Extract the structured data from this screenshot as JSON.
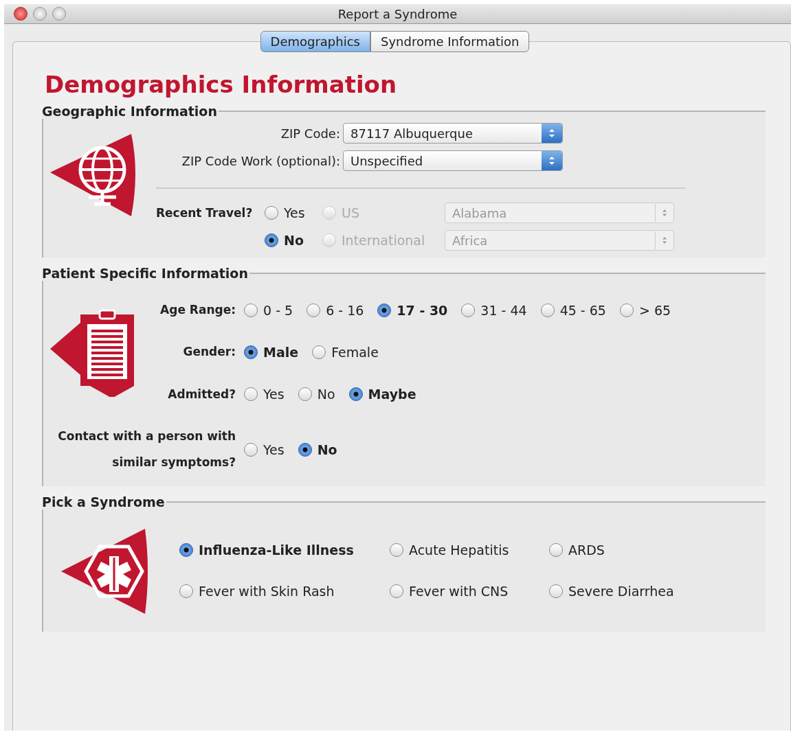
{
  "window": {
    "title": "Report a Syndrome"
  },
  "tabs": [
    {
      "label": "Demographics",
      "selected": true
    },
    {
      "label": "Syndrome Information",
      "selected": false
    }
  ],
  "heading": "Demographics Information",
  "geographic": {
    "title": "Geographic Information",
    "fields": [
      {
        "label": "ZIP Code:",
        "value": "87117 Albuquerque"
      },
      {
        "label": "ZIP Code Work (optional):",
        "value": "Unspecified"
      }
    ],
    "travel": {
      "label": "Recent Travel?",
      "rows": [
        {
          "answer": {
            "label": "Yes",
            "selected": false
          },
          "scope": {
            "label": "US",
            "selected": false,
            "disabled": true
          },
          "place": {
            "value": "Alabama",
            "disabled": true
          }
        },
        {
          "answer": {
            "label": "No",
            "selected": true
          },
          "scope": {
            "label": "International",
            "selected": false,
            "disabled": true
          },
          "place": {
            "value": "Africa",
            "disabled": true
          }
        }
      ]
    }
  },
  "patient": {
    "title": "Patient Specific Information",
    "questions": [
      {
        "label_lines": [
          "Age Range:"
        ],
        "options": [
          {
            "label": "0 - 5",
            "selected": false
          },
          {
            "label": "6 - 16",
            "selected": false
          },
          {
            "label": "17 - 30",
            "selected": true
          },
          {
            "label": "31 - 44",
            "selected": false
          },
          {
            "label": "45 - 65",
            "selected": false
          },
          {
            "label": "> 65",
            "selected": false
          }
        ]
      },
      {
        "label_lines": [
          "Gender:"
        ],
        "options": [
          {
            "label": "Male",
            "selected": true
          },
          {
            "label": "Female",
            "selected": false
          }
        ]
      },
      {
        "label_lines": [
          "Admitted?"
        ],
        "options": [
          {
            "label": "Yes",
            "selected": false
          },
          {
            "label": "No",
            "selected": false
          },
          {
            "label": "Maybe",
            "selected": true
          }
        ]
      },
      {
        "label_lines": [
          "Contact with a person with",
          "similar symptoms?"
        ],
        "options": [
          {
            "label": "Yes",
            "selected": false
          },
          {
            "label": "No",
            "selected": true
          }
        ]
      }
    ]
  },
  "syndrome": {
    "title": "Pick a Syndrome",
    "options": [
      {
        "label": "Influenza-Like Illness",
        "selected": true
      },
      {
        "label": "Acute Hepatitis",
        "selected": false
      },
      {
        "label": "ARDS",
        "selected": false
      },
      {
        "label": "Fever with Skin Rash",
        "selected": false
      },
      {
        "label": "Fever with CNS",
        "selected": false
      },
      {
        "label": "Severe Diarrhea",
        "selected": false
      }
    ]
  }
}
